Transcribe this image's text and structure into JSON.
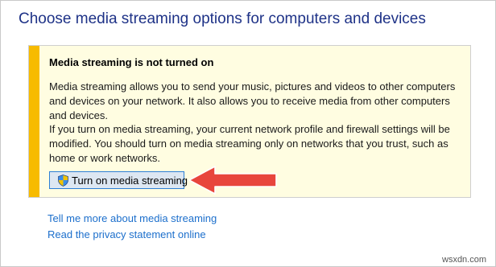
{
  "header": {
    "title": "Choose media streaming options for computers and devices"
  },
  "notice": {
    "heading": "Media streaming is not turned on",
    "paragraph1": "Media streaming allows you to send your music, pictures and videos to other computers and devices on your network.  It also allows you to receive media from other computers and devices.",
    "paragraph2": "If you turn on media streaming, your current network profile and firewall settings will be modified. You should turn on media streaming only on networks that you trust, such as home or work networks.",
    "button_label": "Turn on media streaming",
    "button_icon": "uac-shield-icon"
  },
  "links": {
    "more_info": "Tell me more about media streaming",
    "privacy": "Read the privacy statement online"
  },
  "annotation": {
    "arrow_color": "#e8453c"
  },
  "watermark": "wsxdn.com",
  "colors": {
    "title": "#1e3287",
    "notice_background": "#fffde1",
    "notice_stripe": "#f7bb00",
    "link": "#1c6fcc",
    "button_border": "#2c7fd6"
  }
}
